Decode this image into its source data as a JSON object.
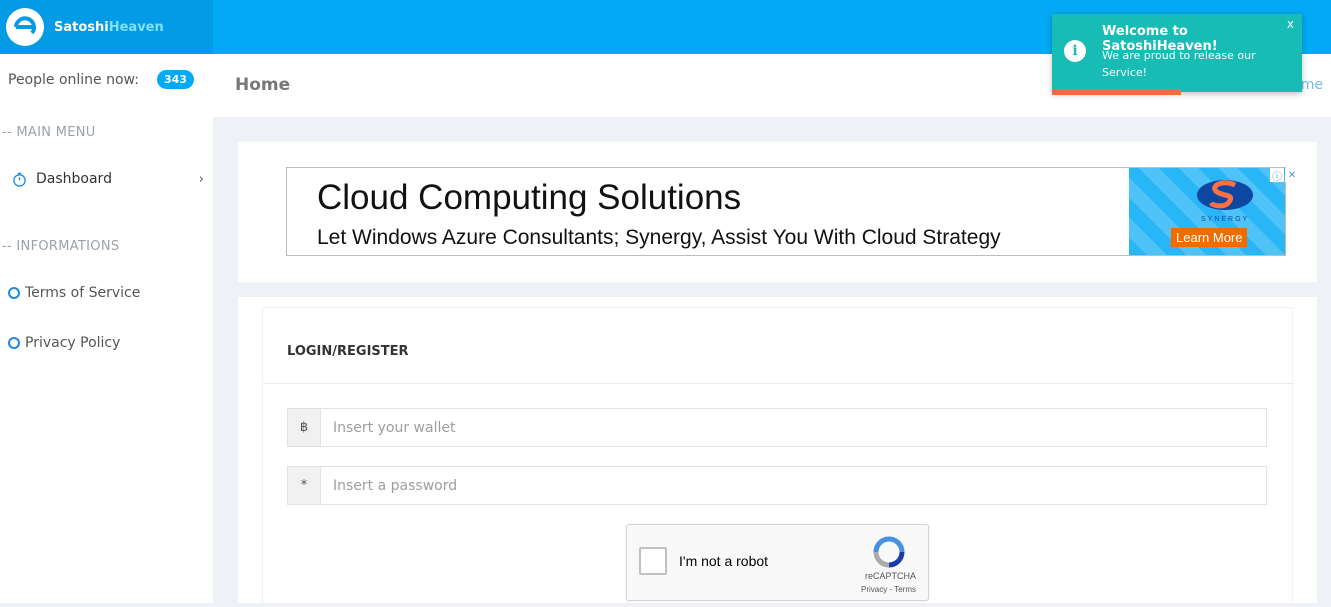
{
  "brand": {
    "name_part1": "Satoshi",
    "name_part2": "Heaven"
  },
  "sidebar": {
    "online_label": "People online now:",
    "online_count": "343",
    "main_menu_heading": "-- MAIN MENU",
    "dashboard_label": "Dashboard",
    "info_heading": "-- INFORMATIONS",
    "terms_label": "Terms of Service",
    "privacy_label": "Privacy Policy"
  },
  "header": {
    "title": "Home",
    "breadcrumb_visible": "me"
  },
  "ad": {
    "title": "Cloud Computing Solutions",
    "subtitle": "Let Windows Azure Consultants; Synergy, Assist You With Cloud Strategy",
    "brand": "SYNERGY",
    "cta": "Learn More",
    "info_glyph": "ⓘ",
    "close_glyph": "✕"
  },
  "login": {
    "heading": "LOGIN/REGISTER",
    "wallet_addon": "฿",
    "wallet_placeholder": "Insert your wallet",
    "password_addon": "*",
    "password_placeholder": "Insert a password"
  },
  "captcha": {
    "label": "I'm not a robot",
    "brand": "reCAPTCHA",
    "links": "Privacy - Terms"
  },
  "toast": {
    "title": "Welcome to SatoshiHeaven!",
    "message": "We are proud to release our Service!",
    "close": "x",
    "icon_glyph": "i"
  },
  "colors": {
    "topbar": "#03a9f4",
    "brand_bg": "#039be5",
    "toast_bg": "#17bcb4",
    "toast_progress": "#f26b46",
    "ad_cta": "#ef6c00"
  }
}
